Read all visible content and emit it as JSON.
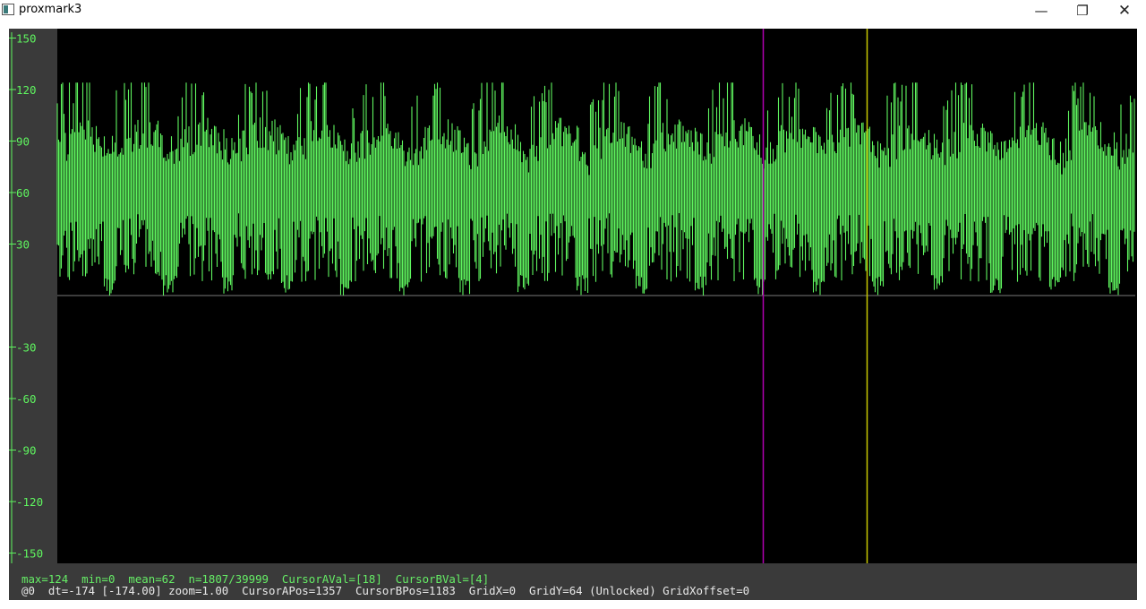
{
  "window": {
    "title": "proxmark3",
    "controls": {
      "minimize_icon": "minimize-icon",
      "restore_icon": "restore-icon",
      "close_icon": "close-icon"
    }
  },
  "plot": {
    "background": "#000000",
    "trace_color": "#5ff55f",
    "axis_color": "#5ff55f",
    "zero_line_color": "#7a7a7a",
    "cursor_a_color": "#b000b0",
    "cursor_b_color": "#c8c800",
    "y_ticks": [
      "150",
      "120",
      "90",
      "60",
      "30",
      "-30",
      "-60",
      "-90",
      "-120",
      "-150"
    ],
    "y_range": [
      -150,
      150
    ]
  },
  "status": {
    "line1": "max=124  min=0  mean=62  n=1807/39999  CursorAVal=[18]  CursorBVal=[4]",
    "line2": "@0  dt=-174 [-174.00] zoom=1.00  CursorAPos=1357  CursorBPos=1183  GridX=0  GridY=64 (Unlocked) GridXoffset=0"
  }
}
